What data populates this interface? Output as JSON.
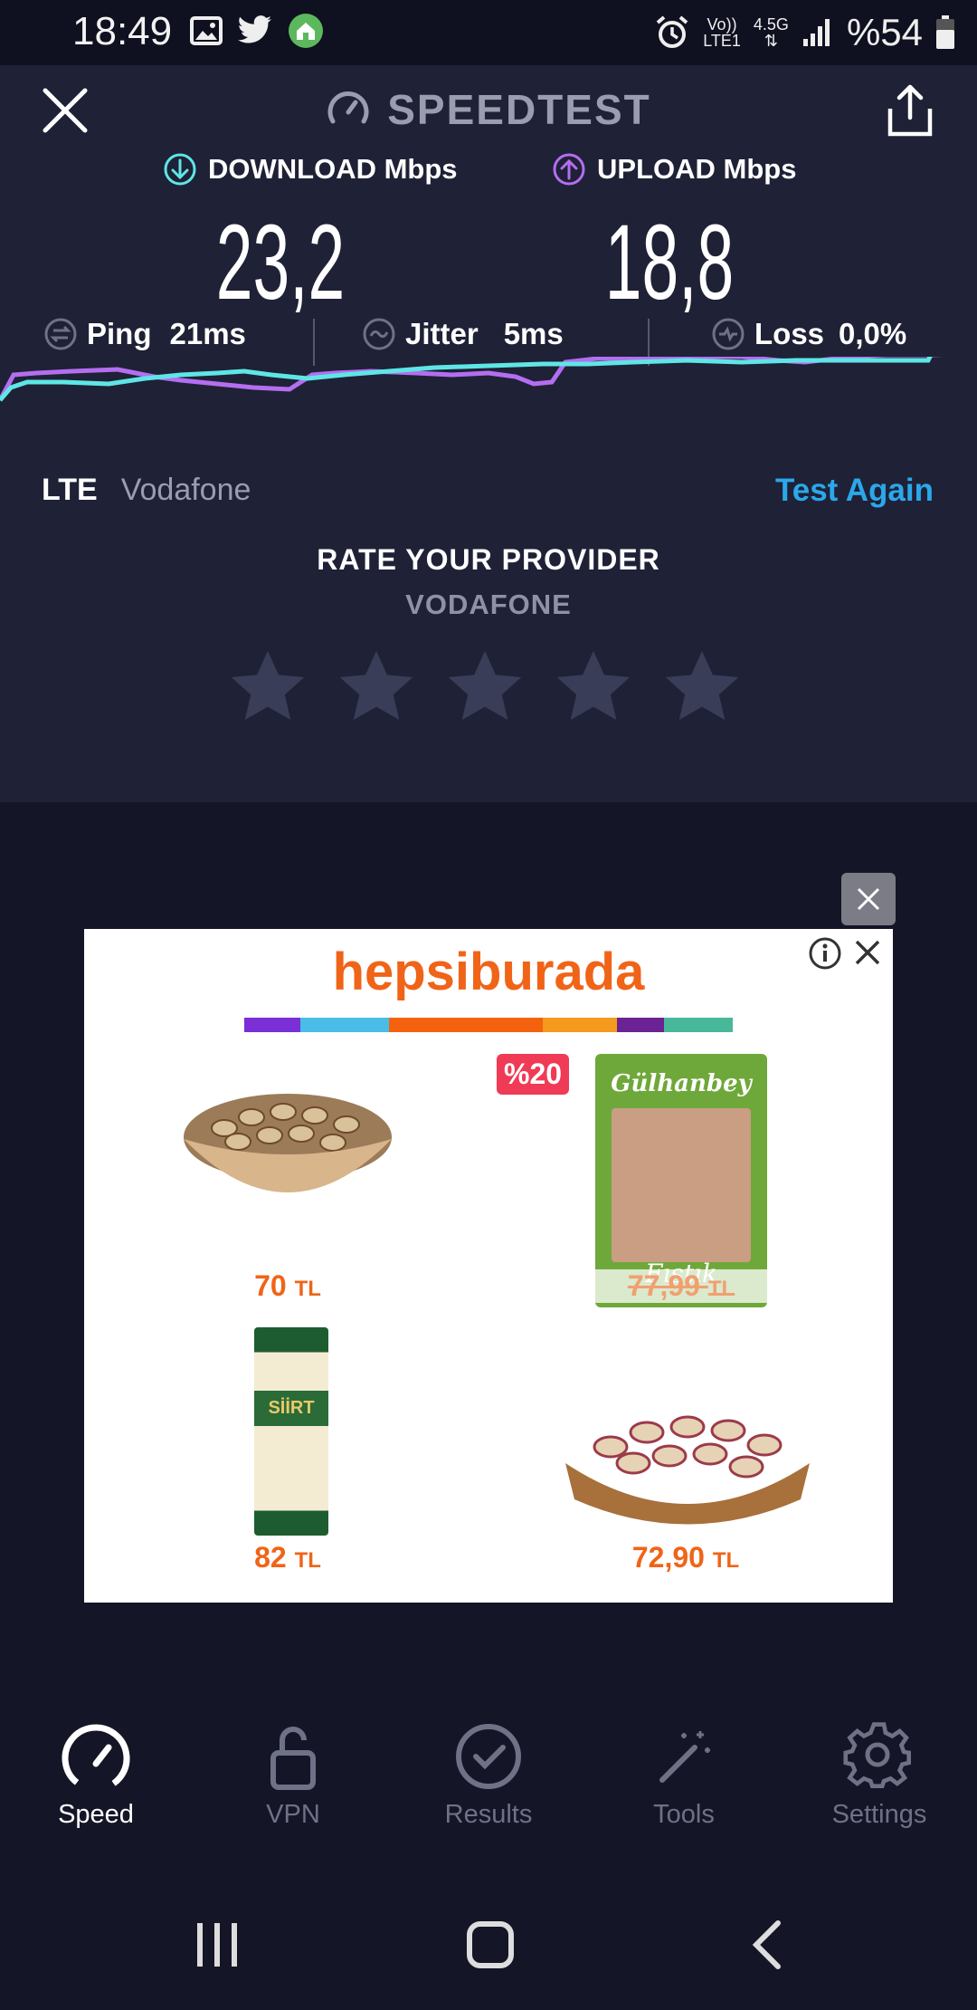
{
  "status_bar": {
    "time": "18:49",
    "volte": "Vo))",
    "lte1": "LTE1",
    "network": "4.5G",
    "battery": "%54"
  },
  "header": {
    "brand": "SPEEDTEST"
  },
  "results": {
    "download_label": "DOWNLOAD Mbps",
    "download_value": "23,2",
    "upload_label": "UPLOAD Mbps",
    "upload_value": "18,8",
    "ping_label": "Ping",
    "ping_value": "21ms",
    "jitter_label": "Jitter",
    "jitter_value": "5ms",
    "loss_label": "Loss",
    "loss_value": "0,0%"
  },
  "network": {
    "type": "LTE",
    "carrier": "Vodafone",
    "test_again": "Test Again"
  },
  "rating": {
    "title": "RATE YOUR PROVIDER",
    "provider": "VODAFONE",
    "stars": 5,
    "selected": 0
  },
  "ad": {
    "brand": "hepsiburada",
    "products": [
      {
        "price": "70",
        "currency": "TL"
      },
      {
        "badge": "%20",
        "price": "77,99",
        "currency": "TL",
        "pack_text": "Gülhanbey",
        "pack_sub": "Fıstık"
      },
      {
        "price": "82",
        "currency": "TL",
        "pack_text": "SİİRT"
      },
      {
        "price": "72,90",
        "currency": "TL"
      }
    ]
  },
  "bottom_nav": {
    "items": [
      {
        "label": "Speed",
        "icon": "speedometer-icon",
        "active": true
      },
      {
        "label": "VPN",
        "icon": "unlock-icon",
        "active": false
      },
      {
        "label": "Results",
        "icon": "check-circle-icon",
        "active": false
      },
      {
        "label": "Tools",
        "icon": "magic-wand-icon",
        "active": false
      },
      {
        "label": "Settings",
        "icon": "gear-icon",
        "active": false
      }
    ]
  },
  "colors": {
    "download": "#5ee6e6",
    "upload": "#b46ef0",
    "accent": "#2aa8ea",
    "ad_orange": "#f06418"
  }
}
